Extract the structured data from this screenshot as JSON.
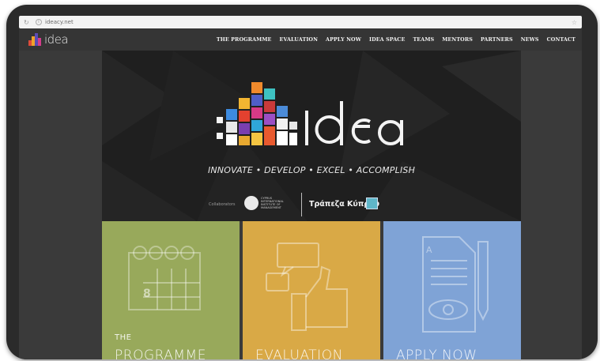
{
  "browser": {
    "url": "ideacy.net"
  },
  "site": {
    "brand_name": "idea",
    "nav": [
      "THE PROGRAMME",
      "EVALUATION",
      "APPLY NOW",
      "IDEA SPACE",
      "TEAMS",
      "MENTORS",
      "PARTNERS",
      "NEWS",
      "CONTACT"
    ]
  },
  "hero": {
    "logo_text": "idea",
    "tagline": "INNOVATE • DEVELOP • EXCEL • ACCOMPLISH",
    "collab_label": "Collaborators",
    "ciim_text": "CYPRUS INTERNATIONAL INSTITUTE OF MANAGEMENT",
    "bank_name": "Τράπεζα Κύπρου"
  },
  "tiles": [
    {
      "pre": "THE",
      "title": "PROGRAMME",
      "icon": "calendar-icon",
      "color": "#98a95b"
    },
    {
      "pre": "",
      "title": "EVALUATION",
      "icon": "thumbs-up-chat-icon",
      "color": "#d9a946"
    },
    {
      "pre": "",
      "title": "APPLY NOW",
      "icon": "document-eye-pencil-icon",
      "color": "#7fa3d6"
    }
  ],
  "colors": {
    "frame": "#2b2b2b",
    "navbar": "#353535",
    "hero_bg": "#1f1f1f"
  }
}
